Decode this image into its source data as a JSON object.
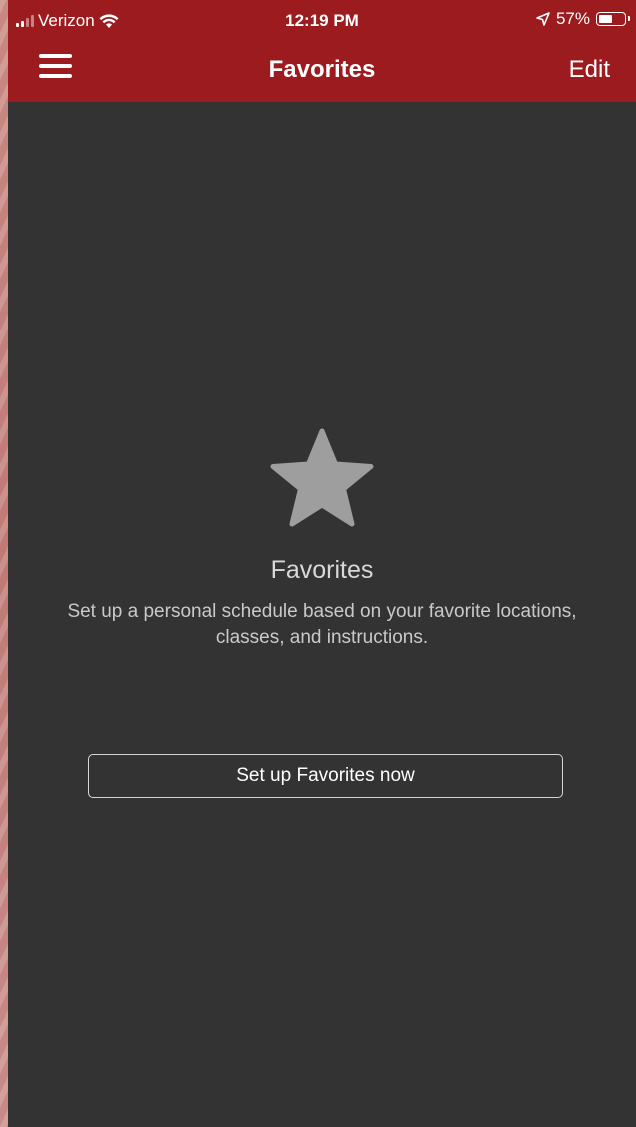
{
  "status_bar": {
    "carrier": "Verizon",
    "time": "12:19 PM",
    "battery": "57%",
    "battery_level": 0.57,
    "icons": [
      "signal-icon",
      "wifi-icon",
      "location-arrow-icon",
      "battery-icon"
    ]
  },
  "nav": {
    "title": "Favorites",
    "edit_label": "Edit",
    "menu_icon": "hamburger-menu-icon"
  },
  "empty_state": {
    "icon": "star-icon",
    "title": "Favorites",
    "description": "Set up a personal schedule based on your favorite locations, classes, and instructions."
  },
  "setup_button": {
    "label": "Set up Favorites now"
  },
  "colors": {
    "header": "#9b1b1f",
    "background": "#333333",
    "star": "#9e9e9e",
    "text": "#ffffff"
  }
}
